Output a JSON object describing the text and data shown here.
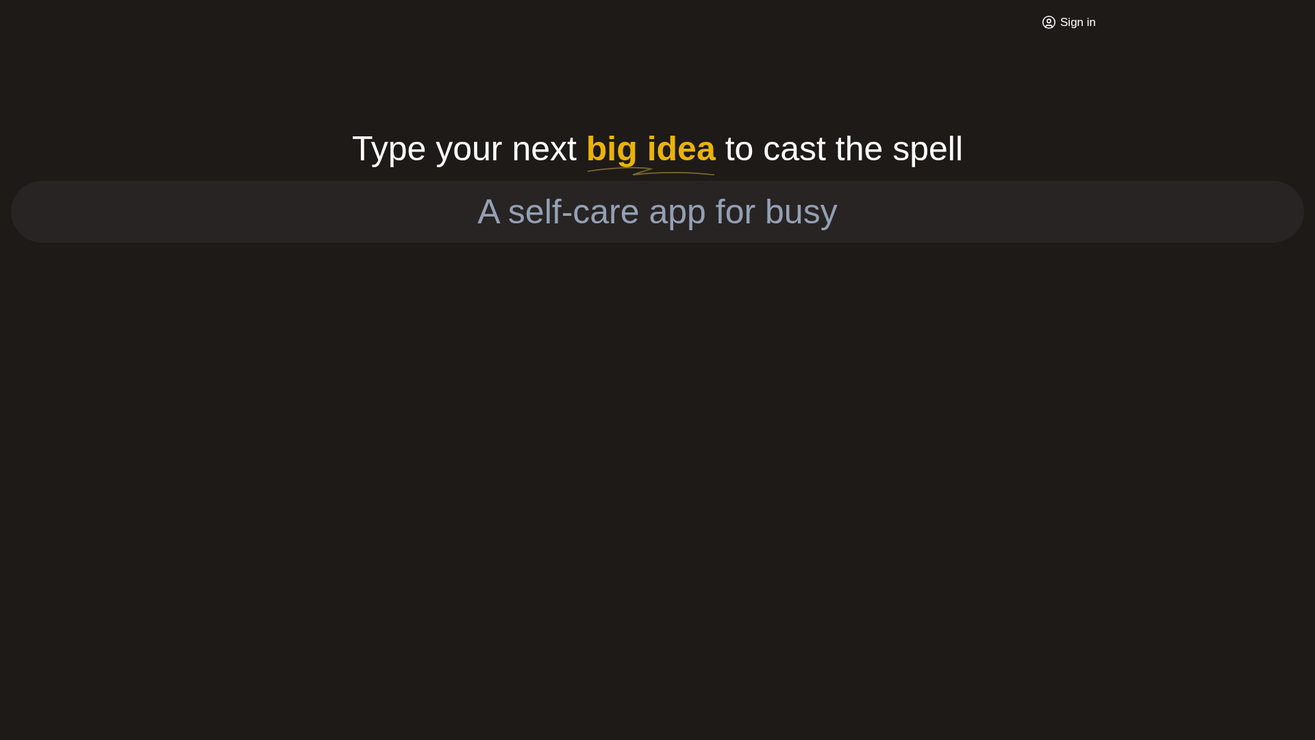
{
  "header": {
    "sign_in": "Sign in"
  },
  "heading": {
    "before": "Type your next ",
    "highlight": "big idea",
    "after": " to cast the spell"
  },
  "idea_field": {
    "placeholder": "A self-care app for busy"
  }
}
